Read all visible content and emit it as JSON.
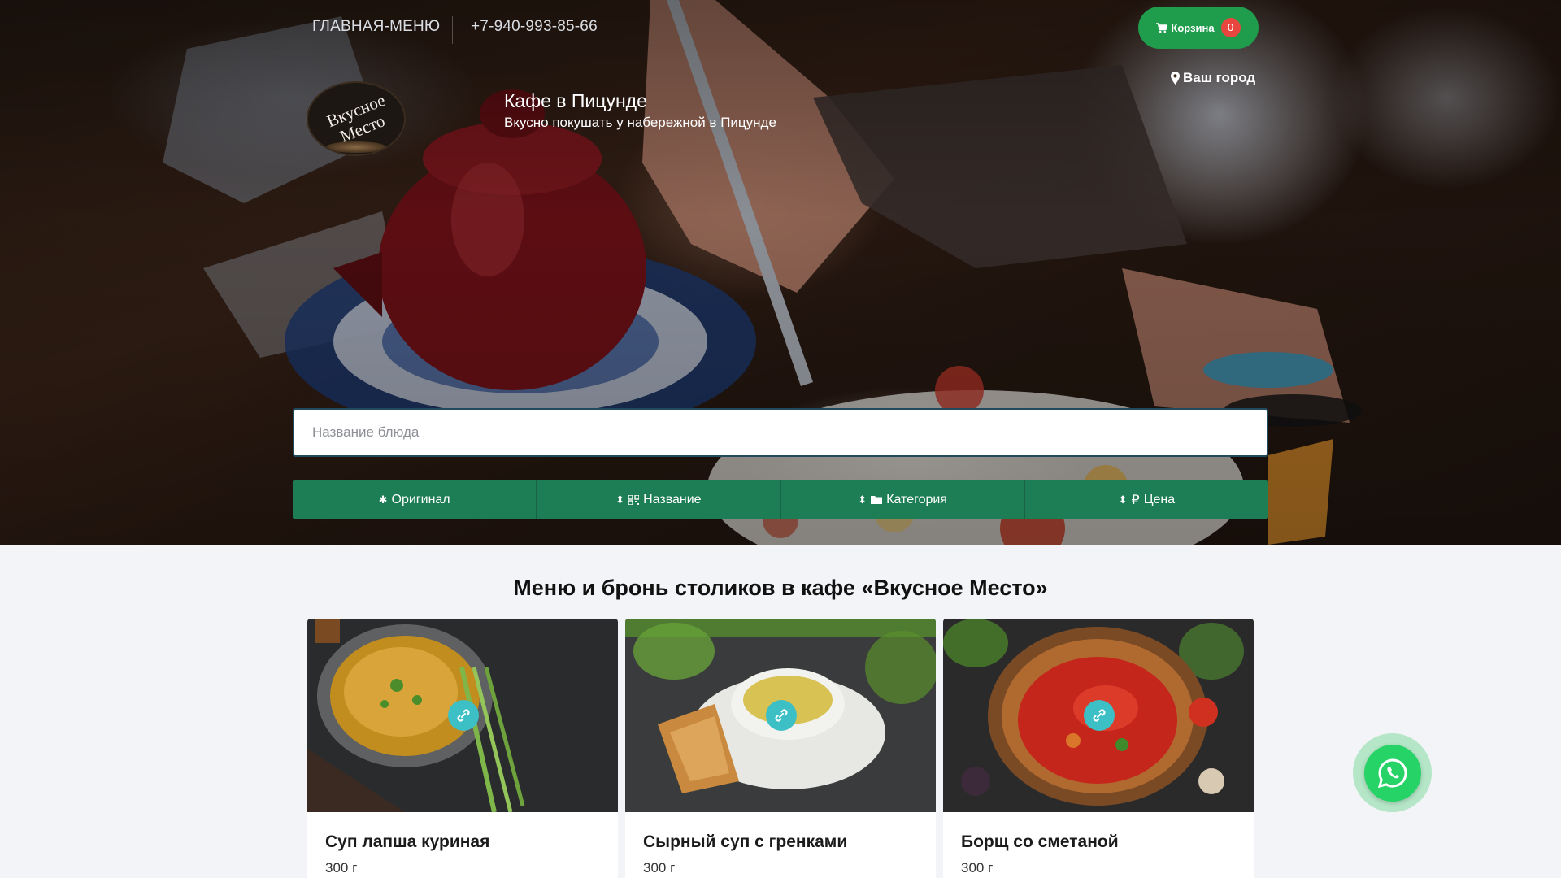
{
  "nav": {
    "menu_link": "ГЛАВНАЯ-МЕНЮ",
    "phone": "+7-940-993-85-66"
  },
  "cart": {
    "label": "Корзина",
    "count": "0",
    "icon": "cart-icon"
  },
  "city": {
    "label": "Ваш город",
    "icon": "map-marker-icon"
  },
  "logo": {
    "line1": "Вкусное",
    "line2": "Место"
  },
  "brand": {
    "title": "Кафе в Пицунде",
    "subtitle": "Вкусно покушать у набережной в Пицунде"
  },
  "search": {
    "placeholder": "Название блюда",
    "value": ""
  },
  "sort": {
    "original": "Оригинал",
    "name": "Название",
    "category": "Категория",
    "price": "Цена"
  },
  "section": {
    "title": "Меню и бронь столиков в кафе «Вкусное Место»"
  },
  "menu_items": [
    {
      "name": "Суп лапша куриная",
      "weight": "300 г"
    },
    {
      "name": "Сырный суп с гренками",
      "weight": "300 г"
    },
    {
      "name": "Борщ со сметаной",
      "weight": "300 г"
    }
  ],
  "colors": {
    "accent_green": "#1d7d55",
    "cart_green": "#1f9d4c",
    "badge_red": "#e8473f",
    "link_badge": "#3dbfc6",
    "whatsapp": "#25d366"
  }
}
